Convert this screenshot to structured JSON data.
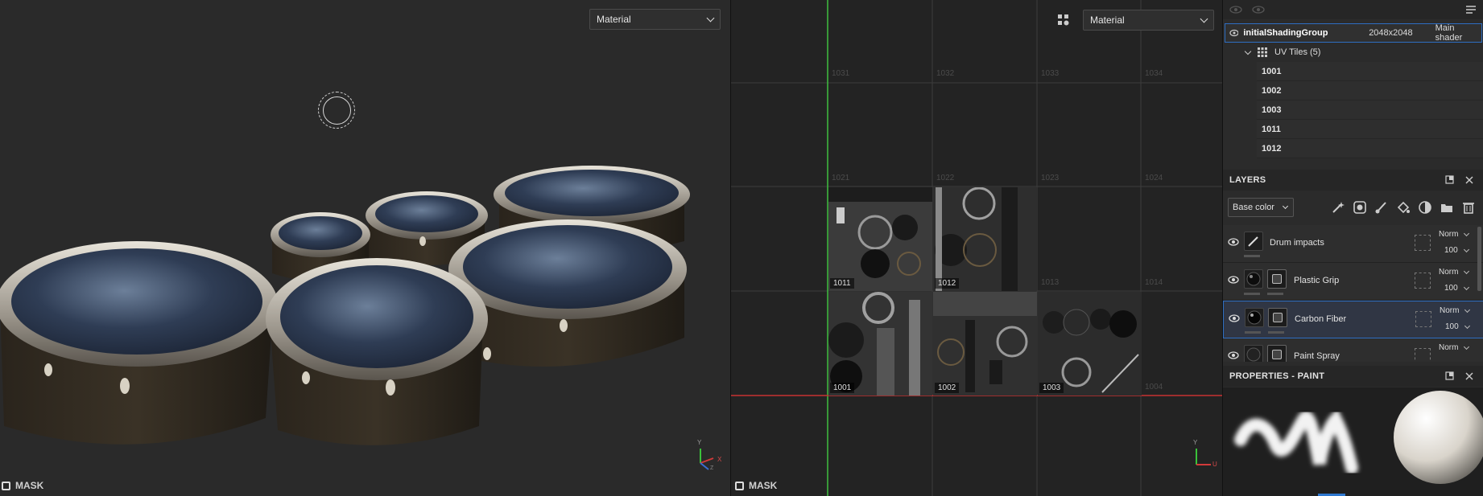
{
  "viewport3d": {
    "display_select": "Material",
    "mask_label": "MASK",
    "axis": {
      "x": "X",
      "y": "Y",
      "z": "Z"
    }
  },
  "viewport2d": {
    "display_select": "Material",
    "mask_label": "MASK",
    "axis": {
      "y": "Y",
      "u": "U"
    },
    "tile_labels_dim": [
      "1031",
      "1032",
      "1033",
      "1034",
      "1021",
      "1022",
      "1023",
      "1024",
      "1013",
      "1014",
      "1004"
    ],
    "tile_labels_lit": [
      "1011",
      "1012",
      "1001",
      "1002",
      "1003"
    ]
  },
  "texture_set": {
    "name": "initialShadingGroup",
    "resolution": "2048x2048",
    "shader": "Main shader",
    "uv_tiles_label": "UV Tiles (5)",
    "tiles": [
      "1001",
      "1002",
      "1003",
      "1011",
      "1012"
    ]
  },
  "layers_panel": {
    "title": "LAYERS",
    "channel": "Base color",
    "layers": [
      {
        "name": "Drum impacts",
        "blend": "Norm",
        "opacity": "100",
        "type": "paint"
      },
      {
        "name": "Plastic Grip",
        "blend": "Norm",
        "opacity": "100",
        "type": "fill"
      },
      {
        "name": "Carbon Fiber",
        "blend": "Norm",
        "opacity": "100",
        "type": "fill",
        "selected": true
      },
      {
        "name": "Paint Spray",
        "blend": "Norm",
        "opacity": "",
        "type": "fill"
      }
    ]
  },
  "properties_panel": {
    "title": "PROPERTIES - PAINT"
  },
  "colors": {
    "accent": "#2e6ec2",
    "uv_u_axis": "#c83232",
    "uv_v_axis": "#32c832"
  }
}
